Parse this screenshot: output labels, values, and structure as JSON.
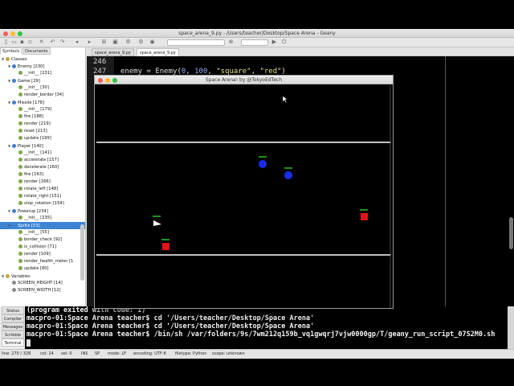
{
  "os_window": {
    "title": "space_arena_9.py - /Users/teacher/Desktop/Space Arena - Geany"
  },
  "toolbar": {
    "icons": [
      "new-file-icon",
      "open-icon",
      "save-icon",
      "save-all-icon",
      "close-icon",
      "back-icon",
      "forward-icon",
      "compile-icon",
      "build-icon",
      "run-icon",
      "color-icon",
      "zoom-in-icon",
      "zoom-out-icon",
      "search-icon",
      "jump-icon",
      "quit-icon"
    ]
  },
  "sidebar": {
    "tabs": [
      "Symbols",
      "Documents"
    ],
    "tree": [
      {
        "label": "Classes",
        "level": 0,
        "arrow": "▼",
        "icon": "folder"
      },
      {
        "label": "Enemy [230]",
        "level": 1,
        "arrow": "▼",
        "icon": "class"
      },
      {
        "label": "__init__ [231]",
        "level": 2,
        "icon": "method"
      },
      {
        "label": "Game [29]",
        "level": 1,
        "arrow": "▼",
        "icon": "class"
      },
      {
        "label": "__init__ [30]",
        "level": 2,
        "icon": "method"
      },
      {
        "label": "render_border [34]",
        "level": 2,
        "icon": "method"
      },
      {
        "label": "Missile [178]",
        "level": 1,
        "arrow": "▼",
        "icon": "class"
      },
      {
        "label": "__init__ [179]",
        "level": 2,
        "icon": "method"
      },
      {
        "label": "fire [188]",
        "level": 2,
        "icon": "method"
      },
      {
        "label": "render [219]",
        "level": 2,
        "icon": "method"
      },
      {
        "label": "reset [213]",
        "level": 2,
        "icon": "method"
      },
      {
        "label": "update [199]",
        "level": 2,
        "icon": "method"
      },
      {
        "label": "Player [140]",
        "level": 1,
        "arrow": "▼",
        "icon": "class"
      },
      {
        "label": "__init__ [141]",
        "level": 2,
        "icon": "method"
      },
      {
        "label": "accelerate [157]",
        "level": 2,
        "icon": "method"
      },
      {
        "label": "decelerate [160]",
        "level": 2,
        "icon": "method"
      },
      {
        "label": "fire [163]",
        "level": 2,
        "icon": "method"
      },
      {
        "label": "render [166]",
        "level": 2,
        "icon": "method"
      },
      {
        "label": "rotate_left [148]",
        "level": 2,
        "icon": "method"
      },
      {
        "label": "rotate_right [151]",
        "level": 2,
        "icon": "method"
      },
      {
        "label": "stop_rotation [154]",
        "level": 2,
        "icon": "method"
      },
      {
        "label": "Powerup [234]",
        "level": 1,
        "arrow": "▼",
        "icon": "class"
      },
      {
        "label": "__init__ [235]",
        "level": 2,
        "icon": "method"
      },
      {
        "label": "Sprite [53]",
        "level": 1,
        "arrow": "▼",
        "icon": "class",
        "selected": true
      },
      {
        "label": "__init__ [55]",
        "level": 2,
        "icon": "method"
      },
      {
        "label": "border_check [92]",
        "level": 2,
        "icon": "method"
      },
      {
        "label": "is_collision [71]",
        "level": 2,
        "icon": "method"
      },
      {
        "label": "render [109]",
        "level": 2,
        "icon": "method"
      },
      {
        "label": "render_health_meter [1",
        "level": 2,
        "icon": "method"
      },
      {
        "label": "update [80]",
        "level": 2,
        "icon": "method"
      },
      {
        "label": "Variables",
        "level": 0,
        "arrow": "▼",
        "icon": "folder"
      },
      {
        "label": "SCREEN_HEIGHT [14]",
        "level": 1,
        "icon": "var"
      },
      {
        "label": "SCREEN_WIDTH [12]",
        "level": 1,
        "icon": "var"
      }
    ]
  },
  "editor": {
    "tabs": [
      "space_arena_9.py",
      "space_arena_9.py"
    ],
    "lines": [
      {
        "num": "246",
        "code": ""
      },
      {
        "num": "247",
        "code": "enemy = Enemy(0, 100, \"square\", \"red\")"
      }
    ]
  },
  "game_window": {
    "title": "Space Arena! by @TokyoEdTech"
  },
  "bottom_panel": {
    "tabs": [
      "Status",
      "Compiler",
      "Messages",
      "Scribble",
      "Terminal"
    ],
    "active_tab": "Terminal",
    "terminal_lines": [
      "(program exited with code: 1)",
      "macpro-01:Space Arena teacher$ cd '/Users/teacher/Desktop/Space Arena'",
      "macpro-01:Space Arena teacher$ /bin/sh /var/folders/9s/7wm212q159b_vq1gwqrj7vjw0000gp/T/geany_run_script_07S2M0.sh"
    ]
  },
  "statusbar": {
    "line": "line: 270 / 328",
    "col": "col: 24",
    "sel": "sel: 0",
    "ins": "INS",
    "sp": "SP",
    "mode": "mode: LF",
    "encoding": "encoding: UTF-8",
    "filetype": "filetype: Python",
    "scope": "scope: unknown"
  },
  "colors": {
    "enemy": "#e0141e",
    "powerup": "#1a2cf0",
    "health": "#2fbf2f",
    "player": "#ffffff",
    "selection": "#3d84d6"
  }
}
